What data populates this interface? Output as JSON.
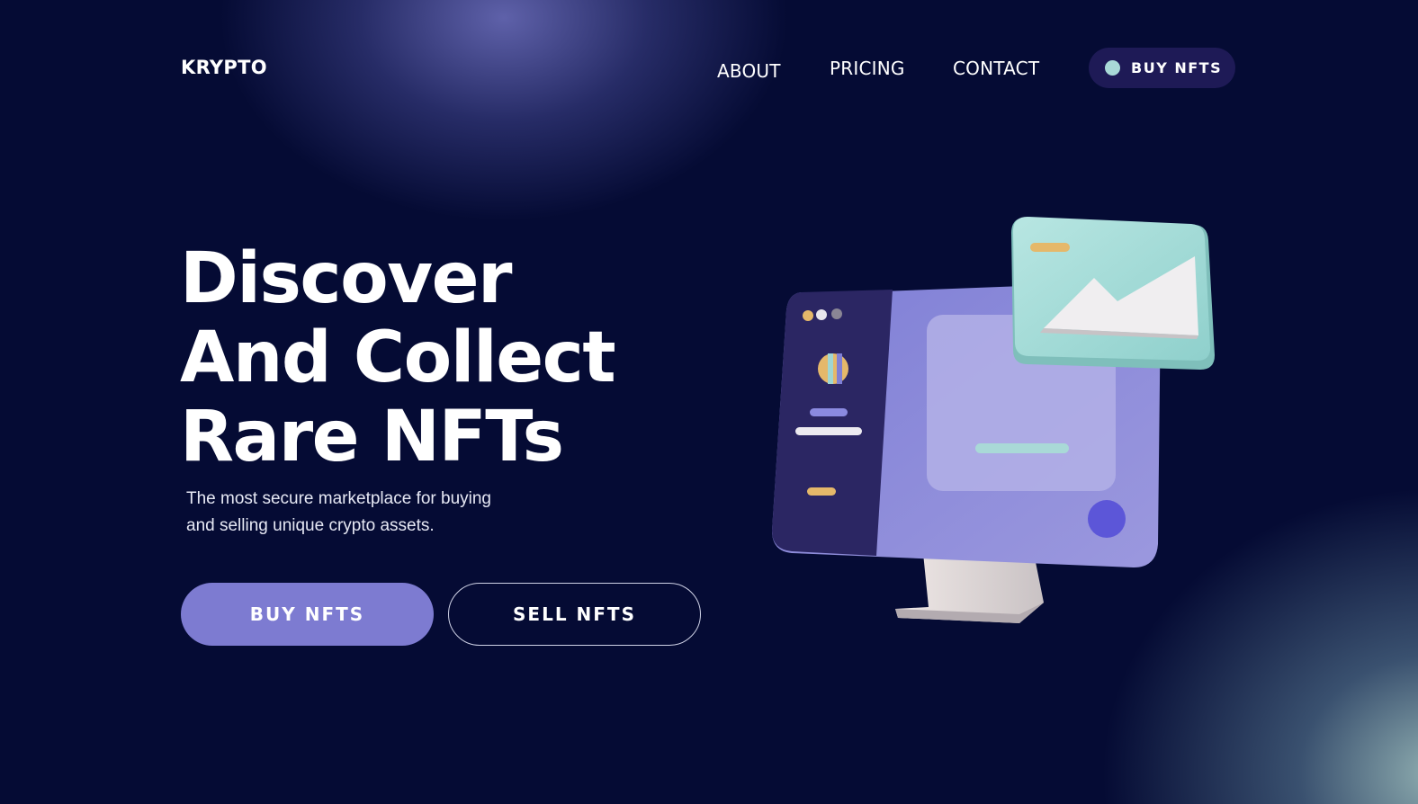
{
  "brand": {
    "logo": "KRYPTO"
  },
  "nav": {
    "items": [
      {
        "label": "ABOUT"
      },
      {
        "label": "PRICING"
      },
      {
        "label": "CONTACT"
      }
    ],
    "cta_label": "BUY NFTS"
  },
  "hero": {
    "headline_lines": [
      "Discover",
      "And Collect",
      "Rare NFTs"
    ],
    "subtext_line1": "The most secure marketplace for buying",
    "subtext_line2": "and selling unique crypto assets.",
    "primary_button": "BUY NFTS",
    "secondary_button": "SELL NFTS"
  },
  "colors": {
    "background": "#050b34",
    "accent": "#7d7bd1",
    "nav_cta_bg": "#1e1a56",
    "teal": "#a9d9d7"
  },
  "icons": [
    "status-dot-icon",
    "monitor-illustration",
    "image-card-icon"
  ]
}
